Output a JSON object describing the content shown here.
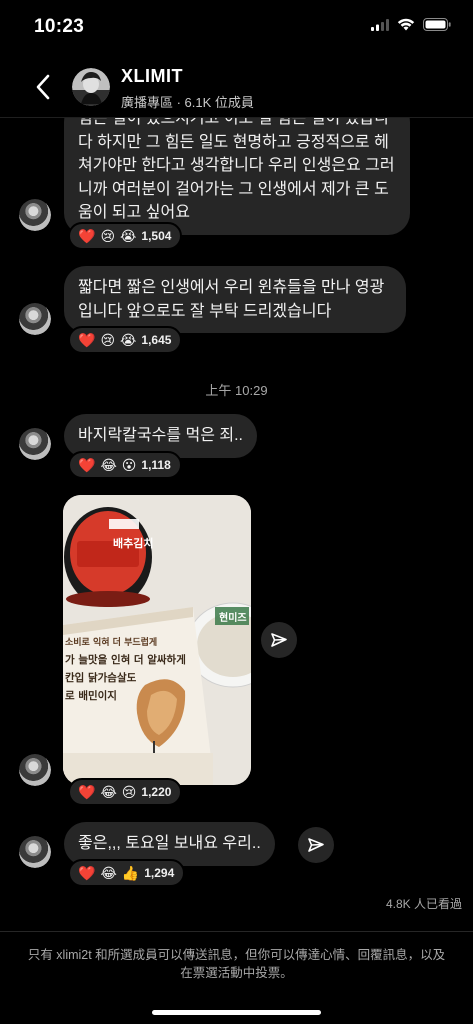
{
  "status_bar": {
    "time": "10:23"
  },
  "header": {
    "title": "XLIMIT",
    "subtitle": "廣播專區 · 6.1K 位成員",
    "icons": [
      "chevron-left-icon"
    ]
  },
  "messages": [
    {
      "text": "힘든 일이 있으시거고 이도 일 힘든 일이 있습니다 하지만 그 힘든 일도 현명하고 긍정적으로 헤쳐가야만 한다고 생각합니다 우리 인생은요 그러니까 여러분이 걸어가는 그 인생에서 제가 큰 도움이 되고 싶어요",
      "reactions": {
        "emojis": [
          "❤️",
          "😢",
          "😭"
        ],
        "count": "1,504"
      }
    },
    {
      "text": "짧다면 짧은 인생에서 우리 윈츄들을 만나 영광입니다 앞으로도 잘 부탁 드리겠습니다",
      "reactions": {
        "emojis": [
          "❤️",
          "😢",
          "😭"
        ],
        "count": "1,645"
      }
    },
    {
      "text": "바지락칼국수를 먹은 죄..",
      "reactions": {
        "emojis": [
          "❤️",
          "😂",
          "😮"
        ],
        "count": "1,118"
      }
    },
    {
      "photo": {
        "kimchi_label": "배추김치",
        "tray_line1": "소비로 익혀 더 부드럽게",
        "tray_line2": "가 늘맛을 인혀 더 알싸하게",
        "tray_line3": "칸입 닭가슴살도",
        "tray_line4": "로 배민이지",
        "rice_label": "현미즈"
      },
      "reactions": {
        "emojis": [
          "❤️",
          "😂",
          "😢"
        ],
        "count": "1,220"
      }
    },
    {
      "text": "좋은,,, 토요일 보내요 우리..",
      "reactions": {
        "emojis": [
          "❤️",
          "😂",
          "👍"
        ],
        "count": "1,294"
      }
    }
  ],
  "timestamp": "上午 10:29",
  "seen_count": "4.8K 人已看過",
  "footer_note": "只有 xlimi2t 和所選成員可以傳送訊息，但你可以傳達心情、回覆訊息，以及在票選活動中投票。",
  "colors": {
    "background": "#000000",
    "bubble": "#262626",
    "muted": "#a8a8a8"
  }
}
